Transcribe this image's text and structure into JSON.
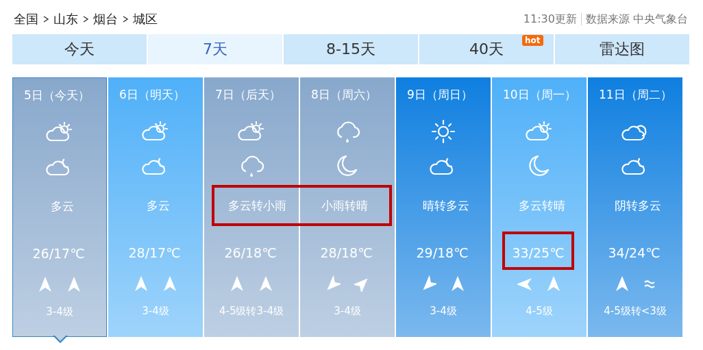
{
  "breadcrumb": [
    "全国",
    "山东",
    "烟台",
    "城区"
  ],
  "update_time": "11:30更新",
  "source": "数据来源 中央气象台",
  "tabs": [
    {
      "label": "今天",
      "selected": false
    },
    {
      "label": "7天",
      "selected": true
    },
    {
      "label": "8-15天",
      "selected": false
    },
    {
      "label": "40天",
      "selected": false,
      "badge": "hot"
    },
    {
      "label": "雷达图",
      "selected": false
    }
  ],
  "days": [
    {
      "date": "5日（今天）",
      "selected": true,
      "color": "#88a8cc",
      "icons": [
        {
          "kind": "partly-cloudy"
        },
        {
          "kind": "cloudy-night"
        }
      ],
      "weather": "多云",
      "weather_marked": false,
      "temp": "26/17℃",
      "temp_marked": false,
      "wind": [
        {
          "kind": "north"
        },
        {
          "kind": "north"
        }
      ],
      "wind_level": "3-4级"
    },
    {
      "date": "6日（明天）",
      "selected": false,
      "color": "#4fb0f8",
      "icons": [
        {
          "kind": "partly-cloudy"
        },
        {
          "kind": "cloudy-night"
        }
      ],
      "weather": "多云",
      "weather_marked": false,
      "temp": "28/17℃",
      "temp_marked": false,
      "wind": [
        {
          "kind": "north"
        },
        {
          "kind": "north"
        }
      ],
      "wind_level": "3-4级"
    },
    {
      "date": "7日（后天）",
      "selected": false,
      "color": "#88a8cc",
      "icons": [
        {
          "kind": "partly-cloudy"
        },
        {
          "kind": "rain"
        }
      ],
      "weather": "多云转小雨",
      "weather_marked": true,
      "temp": "26/18℃",
      "temp_marked": false,
      "wind": [
        {
          "kind": "north"
        },
        {
          "kind": "north"
        }
      ],
      "wind_level": "4-5级转3-4级"
    },
    {
      "date": "8日（周六）",
      "selected": false,
      "color": "#88a8cc",
      "icons": [
        {
          "kind": "rain"
        },
        {
          "kind": "moon"
        }
      ],
      "weather": "小雨转晴",
      "weather_marked": true,
      "temp": "28/18℃",
      "temp_marked": false,
      "wind": [
        {
          "kind": "southwest"
        },
        {
          "kind": "northeast"
        }
      ],
      "wind_level": "3-4级"
    },
    {
      "date": "9日（周日）",
      "selected": false,
      "color": "#0f7fe0",
      "icons": [
        {
          "kind": "sun"
        },
        {
          "kind": "cloudy-night"
        }
      ],
      "weather": "晴转多云",
      "weather_marked": false,
      "temp": "29/18℃",
      "temp_marked": false,
      "wind": [
        {
          "kind": "southwest"
        },
        {
          "kind": "north"
        }
      ],
      "wind_level": "3-4级"
    },
    {
      "date": "10日（周一）",
      "selected": false,
      "color": "#4fb0f8",
      "icons": [
        {
          "kind": "partly-cloudy"
        },
        {
          "kind": "moon"
        }
      ],
      "weather": "多云转晴",
      "weather_marked": false,
      "temp": "33/25℃",
      "temp_marked": true,
      "wind": [
        {
          "kind": "west"
        },
        {
          "kind": "north"
        }
      ],
      "wind_level": "4-5级"
    },
    {
      "date": "11日（周二）",
      "selected": false,
      "color": "#0f7fe0",
      "icons": [
        {
          "kind": "overcast"
        },
        {
          "kind": "cloudy-night"
        }
      ],
      "weather": "阴转多云",
      "weather_marked": false,
      "temp": "34/24℃",
      "temp_marked": false,
      "wind": [
        {
          "kind": "north"
        },
        {
          "kind": "variable"
        }
      ],
      "wind_level": "4-5级转<3级"
    }
  ]
}
